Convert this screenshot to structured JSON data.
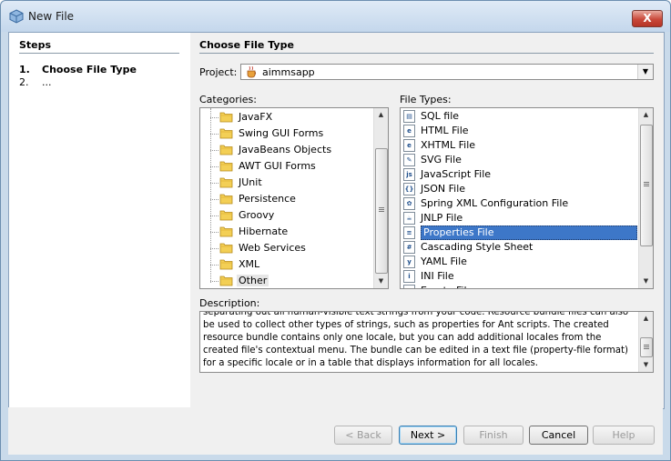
{
  "window": {
    "title": "New File",
    "close_label": "X"
  },
  "steps": {
    "title": "Steps",
    "items": [
      {
        "num": "1.",
        "label": "Choose File Type"
      },
      {
        "num": "2.",
        "label": "..."
      }
    ]
  },
  "main": {
    "title": "Choose File Type",
    "project_label": "Project:",
    "project_value": "aimmsapp",
    "categories_label": "Categories:",
    "filetypes_label": "File Types:",
    "categories": [
      "JavaFX",
      "Swing GUI Forms",
      "JavaBeans Objects",
      "AWT GUI Forms",
      "JUnit",
      "Persistence",
      "Groovy",
      "Hibernate",
      "Web Services",
      "XML",
      "Other"
    ],
    "categories_highlighted": "Other",
    "file_types": [
      {
        "label": "SQL file",
        "icon": "sql-file-icon"
      },
      {
        "label": "HTML File",
        "icon": "html-file-icon"
      },
      {
        "label": "XHTML File",
        "icon": "xhtml-file-icon"
      },
      {
        "label": "SVG File",
        "icon": "svg-file-icon"
      },
      {
        "label": "JavaScript File",
        "icon": "javascript-file-icon"
      },
      {
        "label": "JSON File",
        "icon": "json-file-icon"
      },
      {
        "label": "Spring XML Configuration File",
        "icon": "spring-file-icon"
      },
      {
        "label": "JNLP File",
        "icon": "jnlp-file-icon"
      },
      {
        "label": "Properties File",
        "icon": "properties-file-icon"
      },
      {
        "label": "Cascading Style Sheet",
        "icon": "css-file-icon"
      },
      {
        "label": "YAML File",
        "icon": "yaml-file-icon"
      },
      {
        "label": "INI File",
        "icon": "ini-file-icon"
      },
      {
        "label": "Empty File",
        "icon": "empty-file-icon"
      }
    ],
    "file_types_selected": "Properties File",
    "description_label": "Description:",
    "description": "separating out all human-visible text strings from your code. Resource bundle files can also be used to collect other types of strings, such as properties for Ant scripts. The created resource bundle contains only one locale, but you can add additional locales from the created file's contextual menu. The bundle can be edited in a text file (property-file format) for a specific locale or in a table that displays information for all locales."
  },
  "buttons": {
    "back": "< Back",
    "next": "Next >",
    "finish": "Finish",
    "cancel": "Cancel",
    "help": "Help"
  },
  "colors": {
    "selection": "#3d77c8",
    "frame": "#c9daea"
  }
}
